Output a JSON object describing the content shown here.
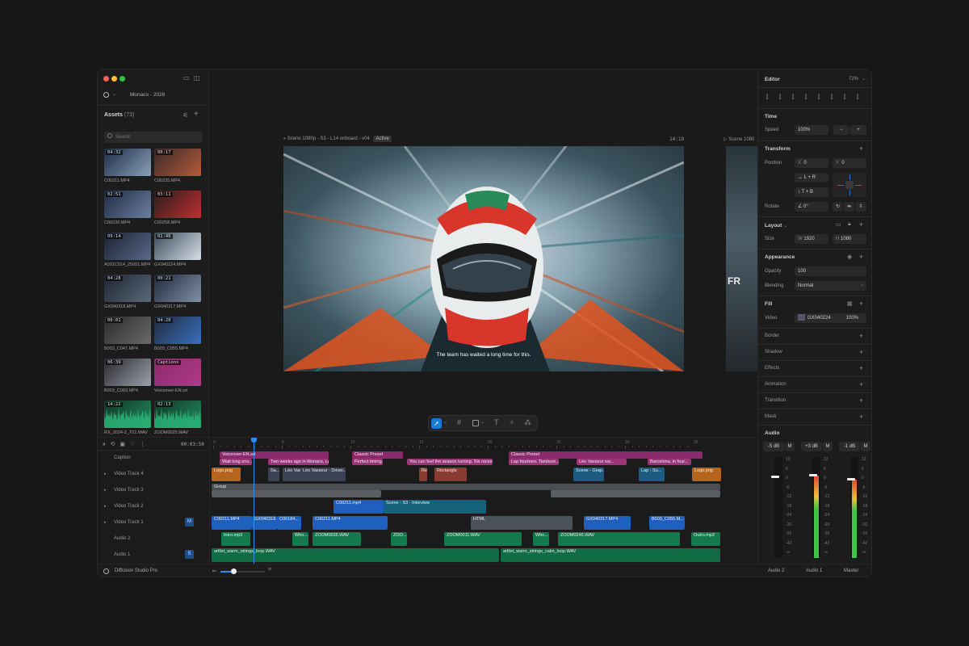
{
  "project": {
    "name": "Monaco - 2026"
  },
  "assets": {
    "title": "Assets",
    "count": "(73)",
    "search_placeholder": "Search",
    "items": [
      {
        "name": "C00211.MP4",
        "duration": "04:32"
      },
      {
        "name": "C00235.MP4",
        "duration": "00:17"
      },
      {
        "name": "C00236.MP4",
        "duration": "02:51"
      },
      {
        "name": "C00258.MP4",
        "duration": "03:11"
      },
      {
        "name": "A001C014_25051.MP4",
        "duration": "09:14"
      },
      {
        "name": "GX040224.MP4",
        "duration": "01:46"
      },
      {
        "name": "GX040318.MP4",
        "duration": "04:28"
      },
      {
        "name": "GX040317.MP4",
        "duration": "00:21"
      },
      {
        "name": "B003_C047.MP4",
        "duration": "00:01"
      },
      {
        "name": "B003_C055.MP4",
        "duration": "04:20"
      },
      {
        "name": "B003_C093.MP4",
        "duration": "06:39"
      },
      {
        "name": "Voiceover-EN.srt",
        "duration": "Captions"
      },
      {
        "name": "RX_2024-2_T01.WAV",
        "duration": "14:22"
      },
      {
        "name": "ZOOM0025.WAV",
        "duration": "02:13"
      }
    ]
  },
  "scene": {
    "title": "Scene 1080p - S3 - L14 onboard - v04",
    "badge": "Active",
    "time": "14:18",
    "next": "Scene 1080",
    "caption": "The team has waited a long time for this."
  },
  "toolbar": {
    "tools": [
      "pointer-tool",
      "grid-tool",
      "shape-tool",
      "text-tool",
      "effects-tool",
      "group-tool"
    ]
  },
  "editor": {
    "title": "Editor",
    "zoom": "72%",
    "time": {
      "section": "Time",
      "speed_label": "Speed",
      "speed": "100%"
    },
    "transform": {
      "section": "Transform",
      "position_label": "Position",
      "x_label": "X",
      "x": "0",
      "y_label": "Y",
      "y": "0",
      "anchor_h": "L + R",
      "anchor_v": "T + B",
      "rotate_label": "Rotate",
      "rotate": "0°"
    },
    "layout": {
      "section": "Layout",
      "size_label": "Size",
      "w_label": "W",
      "w": "1920",
      "h_label": "H",
      "h": "1080"
    },
    "appearance": {
      "section": "Appearance",
      "opacity_label": "Opacity",
      "opacity": "100",
      "blending_label": "Blending",
      "blending": "Normal"
    },
    "fill": {
      "section": "Fill",
      "video_label": "Video",
      "video": "GX040224",
      "video_pct": "100%"
    },
    "collapsed": [
      "Border",
      "Shadow",
      "Effects",
      "Animation",
      "Transition",
      "Mask"
    ],
    "audio": {
      "section": "Audio",
      "channels": [
        {
          "name": "Audio 2",
          "gain": "-5 dB",
          "level": 0.0
        },
        {
          "name": "Audio 1",
          "gain": "+3 dB",
          "level": 0.82
        },
        {
          "name": "Master",
          "gain": "-1 dB",
          "level": 0.78
        }
      ],
      "mute": "M",
      "scale": [
        "12",
        "6",
        "0",
        "-6",
        "-12",
        "-18",
        "-24",
        "-30",
        "-36",
        "-42",
        "-∞"
      ]
    }
  },
  "timeline": {
    "timecode": "00:03:50",
    "ruler": [
      "0",
      "5",
      "10",
      "15",
      "20",
      "25",
      "30",
      "35"
    ],
    "tracks": [
      {
        "name": "Caption",
        "badge": ""
      },
      {
        "name": "Video Track 4",
        "badge": ""
      },
      {
        "name": "Video Track 3",
        "badge": ""
      },
      {
        "name": "Video Track 2",
        "badge": ""
      },
      {
        "name": "Video Track 1",
        "badge": "M"
      },
      {
        "name": "Audio 2",
        "badge": ""
      },
      {
        "name": "Audio 1",
        "badge": "S"
      }
    ],
    "clips": {
      "caption_file": "Voiceover-EN.srt",
      "c1": "Wait long eno...",
      "c2": "Two weeks ago in Monaco, Léo",
      "preset1": "Classic Preset",
      "c3": "Perfect timing.",
      "c4": "You can feel the season turning. Six races in",
      "preset2": "Classic Preset",
      "c5": "Lap fourteen. Tambure...",
      "c6": "Léo Vasseur wa...",
      "c7": "Barcelona, in four...",
      "v4": [
        "Logo.png",
        "Sa...",
        "Léo Vasseur - Driver...",
        "Re...",
        "Rectangle",
        "Scene - Grap...",
        "Lap - Su...",
        "Logo.png"
      ],
      "group": "Group",
      "v2": [
        "C00211.mp4",
        "Scene - S3 - Interview"
      ],
      "v1": [
        "C00211.MP4",
        "GX040318...",
        "C00184...",
        "C00211.MP4",
        "GX040317.MP4",
        "HTML",
        "GX040317.MP4",
        "B003_C055.M..."
      ],
      "a2": [
        "Intro.mp3",
        "Who...",
        "ZOOM0025.WAV",
        "ZOO...",
        "ZOOM0011.WAV",
        "Who...",
        "ZOOM0245.WAV",
        "Outro.mp3"
      ],
      "a1": [
        "artlist_warm_strings_loop.WAV",
        "artlist_warm_strings_calm_loop.WAV"
      ]
    }
  },
  "app": {
    "name": "Diffusion Studio Pro"
  }
}
